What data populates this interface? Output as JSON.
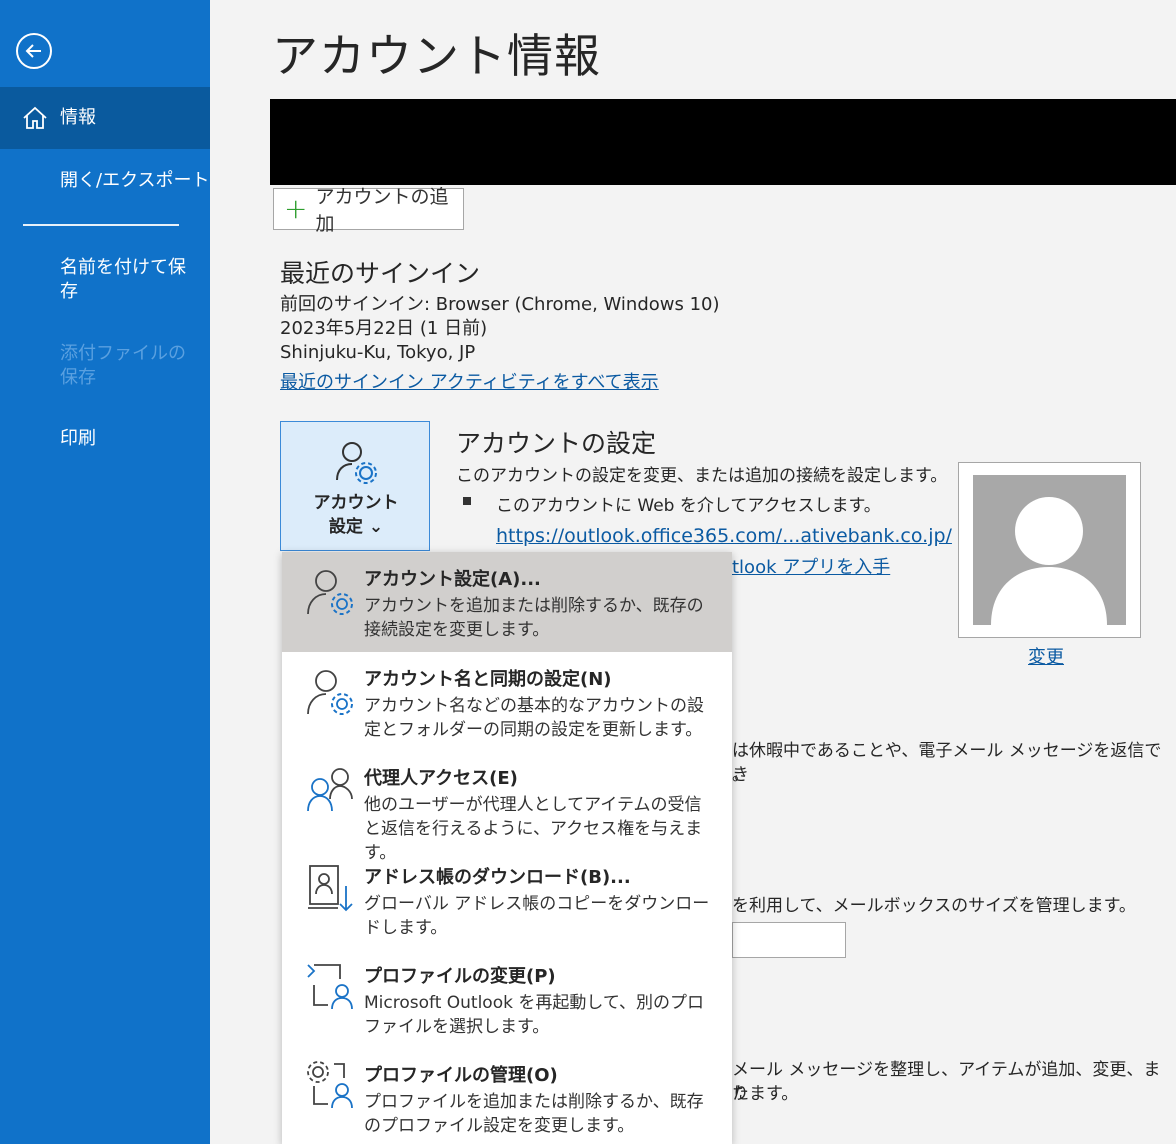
{
  "sidebar": {
    "items": [
      {
        "label": "情報"
      },
      {
        "label": "開く/エクスポート"
      },
      {
        "label": "名前を付けて保存"
      },
      {
        "label": "添付ファイルの保存"
      },
      {
        "label": "印刷"
      }
    ]
  },
  "main": {
    "title": "アカウント情報",
    "add_account_label": "アカウントの追加",
    "recent": {
      "title": "最近のサインイン",
      "line1": "前回のサインイン: Browser (Chrome, Windows 10)",
      "line2": "2023年5月22日 (1 日前)",
      "line3": "Shinjuku-Ku, Tokyo, JP",
      "link": "最近のサインイン アクティビティをすべて表示"
    },
    "account_settings_button": {
      "line1": "アカウント",
      "line2": "設定 ⌄"
    },
    "settings": {
      "title": "アカウントの設定",
      "desc": "このアカウントの設定を変更、または追加の接続を設定します。",
      "bullet": "このアカウントに Web を介してアクセスします。",
      "url": "https://outlook.office365.com/...ativebank.co.jp/",
      "app_link_fragment": "tlook アプリを入手"
    },
    "change_link": "変更",
    "partial": {
      "ooo_line1": "は休暇中であることや、電子メール メッセージを返信でき",
      "ooo_line2": "。",
      "mailbox": "を利用して、メールボックスのサイズを管理します。",
      "rules_line1": "メール メッセージを整理し、アイテムが追加、変更、また",
      "rules_line2": "ります。"
    }
  },
  "dropdown": {
    "items": [
      {
        "title": "アカウント設定(A)...",
        "desc": "アカウントを追加または削除するか、既存の接続設定を変更します。",
        "icon": "account-settings-icon"
      },
      {
        "title": "アカウント名と同期の設定(N)",
        "desc": "アカウント名などの基本的なアカウントの設定とフォルダーの同期の設定を更新します。",
        "icon": "account-sync-icon"
      },
      {
        "title": "代理人アクセス(E)",
        "desc": "他のユーザーが代理人としてアイテムの受信と返信を行えるように、アクセス権を与えます。",
        "icon": "delegate-icon"
      },
      {
        "title": "アドレス帳のダウンロード(B)...",
        "desc": "グローバル アドレス帳のコピーをダウンロードします。",
        "icon": "address-book-download-icon"
      },
      {
        "title": "プロファイルの変更(P)",
        "desc": "Microsoft Outlook を再起動して、別のプロファイルを選択します。",
        "icon": "change-profile-icon"
      },
      {
        "title": "プロファイルの管理(O)",
        "desc": "プロファイルを追加または削除するか、既存のプロファイル設定を変更します。",
        "icon": "manage-profile-icon"
      }
    ]
  }
}
